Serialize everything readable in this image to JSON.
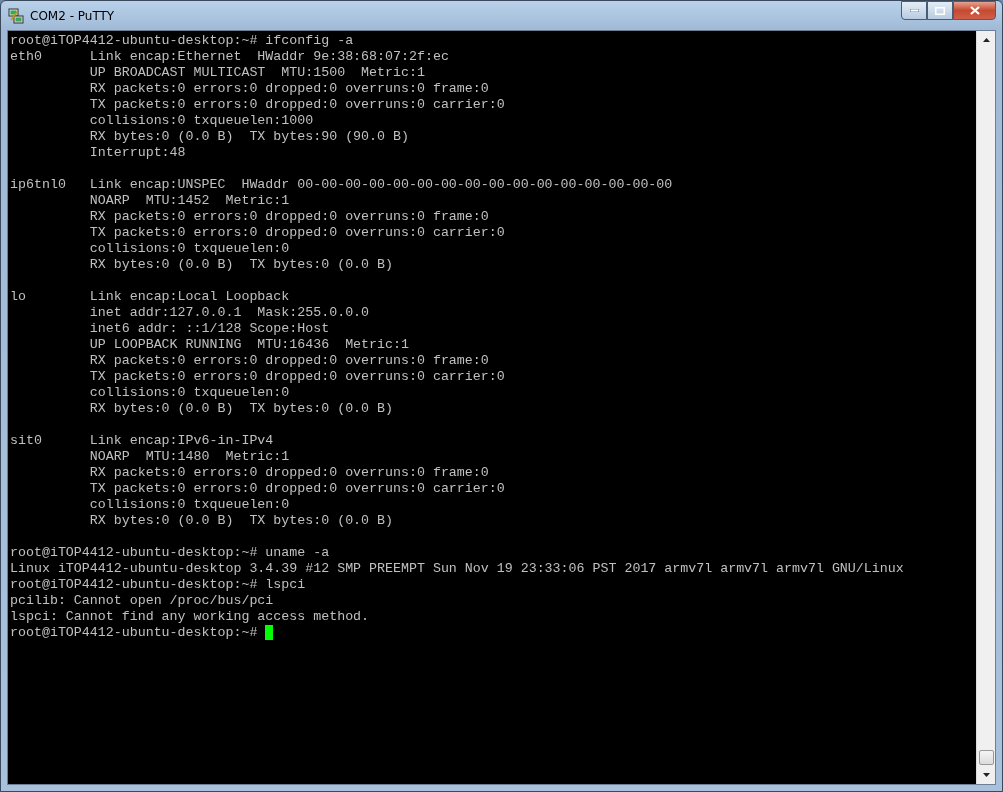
{
  "window": {
    "title": "COM2 - PuTTY"
  },
  "terminal": {
    "blocks": [
      [
        "root@iTOP4412-ubuntu-desktop:~# ifconfig -a",
        "eth0      Link encap:Ethernet  HWaddr 9e:38:68:07:2f:ec",
        "          UP BROADCAST MULTICAST  MTU:1500  Metric:1",
        "          RX packets:0 errors:0 dropped:0 overruns:0 frame:0",
        "          TX packets:0 errors:0 dropped:0 overruns:0 carrier:0",
        "          collisions:0 txqueuelen:1000",
        "          RX bytes:0 (0.0 B)  TX bytes:90 (90.0 B)",
        "          Interrupt:48"
      ],
      [
        "ip6tnl0   Link encap:UNSPEC  HWaddr 00-00-00-00-00-00-00-00-00-00-00-00-00-00-00-00",
        "          NOARP  MTU:1452  Metric:1",
        "          RX packets:0 errors:0 dropped:0 overruns:0 frame:0",
        "          TX packets:0 errors:0 dropped:0 overruns:0 carrier:0",
        "          collisions:0 txqueuelen:0",
        "          RX bytes:0 (0.0 B)  TX bytes:0 (0.0 B)"
      ],
      [
        "lo        Link encap:Local Loopback",
        "          inet addr:127.0.0.1  Mask:255.0.0.0",
        "          inet6 addr: ::1/128 Scope:Host",
        "          UP LOOPBACK RUNNING  MTU:16436  Metric:1",
        "          RX packets:0 errors:0 dropped:0 overruns:0 frame:0",
        "          TX packets:0 errors:0 dropped:0 overruns:0 carrier:0",
        "          collisions:0 txqueuelen:0",
        "          RX bytes:0 (0.0 B)  TX bytes:0 (0.0 B)"
      ],
      [
        "sit0      Link encap:IPv6-in-IPv4",
        "          NOARP  MTU:1480  Metric:1",
        "          RX packets:0 errors:0 dropped:0 overruns:0 frame:0",
        "          TX packets:0 errors:0 dropped:0 overruns:0 carrier:0",
        "          collisions:0 txqueuelen:0",
        "          RX bytes:0 (0.0 B)  TX bytes:0 (0.0 B)"
      ],
      [
        "root@iTOP4412-ubuntu-desktop:~# uname -a",
        "Linux iTOP4412-ubuntu-desktop 3.4.39 #12 SMP PREEMPT Sun Nov 19 23:33:06 PST 2017 armv7l armv7l armv7l GNU/Linux",
        "root@iTOP4412-ubuntu-desktop:~# lspci",
        "pcilib: Cannot open /proc/bus/pci",
        "lspci: Cannot find any working access method.",
        "root@iTOP4412-ubuntu-desktop:~# "
      ]
    ]
  }
}
